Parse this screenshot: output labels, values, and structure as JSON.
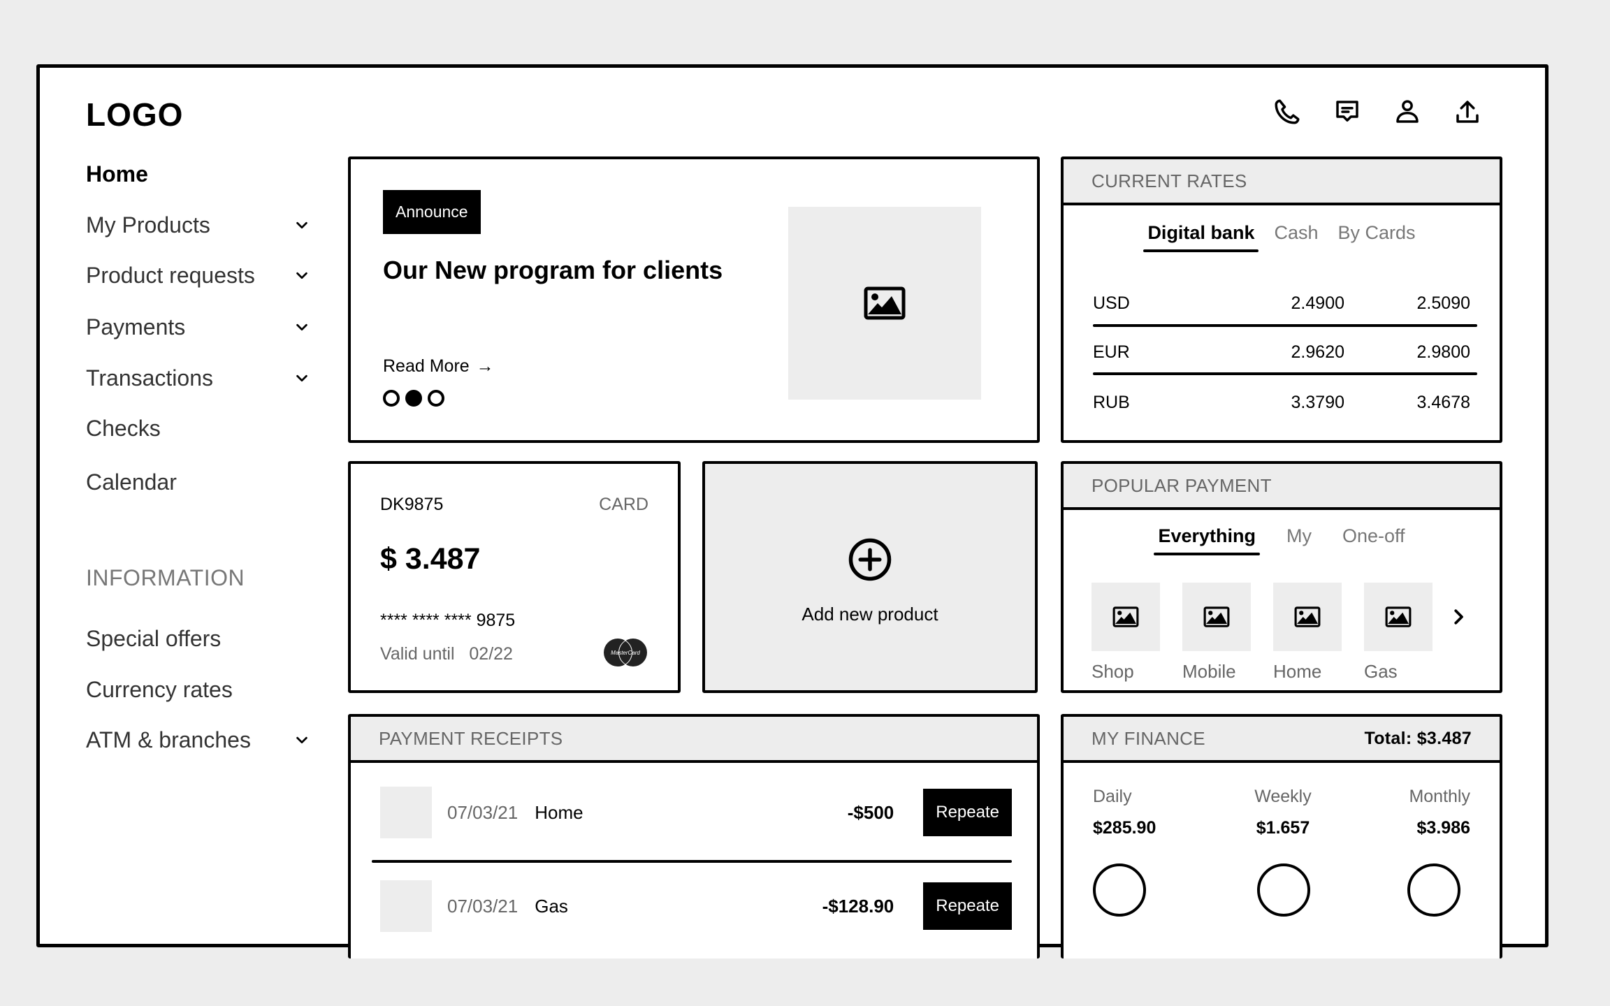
{
  "header": {
    "logo": "LOGO",
    "icons": [
      "phone-icon",
      "chat-icon",
      "user-icon",
      "upload-icon"
    ]
  },
  "sidebar": {
    "items": [
      {
        "label": "Home",
        "active": true,
        "expandable": false
      },
      {
        "label": "My Products",
        "expandable": true
      },
      {
        "label": "Product requests",
        "expandable": true
      },
      {
        "label": "Payments",
        "expandable": true
      },
      {
        "label": "Transactions",
        "expandable": true
      },
      {
        "label": "Checks",
        "expandable": false
      },
      {
        "label": "Calendar",
        "expandable": false
      }
    ],
    "info_heading": "INFORMATION",
    "info_items": [
      {
        "label": "Special offers",
        "expandable": false
      },
      {
        "label": "Currency rates",
        "expandable": false
      },
      {
        "label": "ATM & branches",
        "expandable": true
      }
    ]
  },
  "announce": {
    "badge": "Announce",
    "title": "Our New program for clients",
    "read_more": "Read More",
    "read_more_arrow": "→",
    "carousel_total": 3,
    "carousel_active": 2
  },
  "rates": {
    "title": "CURRENT RATES",
    "tabs": [
      {
        "label": "Digital bank",
        "active": true
      },
      {
        "label": "Cash",
        "active": false
      },
      {
        "label": "By Cards",
        "active": false
      }
    ],
    "rows": [
      {
        "currency": "USD",
        "buy": "2.4900",
        "sell": "2.5090"
      },
      {
        "currency": "EUR",
        "buy": "2.9620",
        "sell": "2.9800"
      },
      {
        "currency": "RUB",
        "buy": "3.3790",
        "sell": "3.4678"
      }
    ]
  },
  "card": {
    "id": "DK9875",
    "type": "CARD",
    "balance": "$ 3.487",
    "number": "**** **** **** 9875",
    "valid_label": "Valid until",
    "valid_date": "02/22",
    "brand": "MasterCard"
  },
  "add_product": {
    "label": "Add new product"
  },
  "popular": {
    "title": "POPULAR PAYMENT",
    "tabs": [
      {
        "label": "Everything",
        "active": true
      },
      {
        "label": "My",
        "active": false
      },
      {
        "label": "One-off",
        "active": false
      }
    ],
    "items": [
      {
        "label": "Shop"
      },
      {
        "label": "Mobile"
      },
      {
        "label": "Home"
      },
      {
        "label": "Gas"
      }
    ]
  },
  "receipts": {
    "title": "PAYMENT RECEIPTS",
    "rows": [
      {
        "date": "07/03/21",
        "name": "Home",
        "amount": "-$500",
        "action": "Repeate"
      },
      {
        "date": "07/03/21",
        "name": "Gas",
        "amount": "-$128.90",
        "action": "Repeate"
      }
    ]
  },
  "finance": {
    "title": "MY FINANCE",
    "total": "Total: $3.487",
    "periods": [
      {
        "label": "Daily",
        "value": "$285.90"
      },
      {
        "label": "Weekly",
        "value": "$1.657"
      },
      {
        "label": "Monthly",
        "value": "$3.986"
      }
    ]
  }
}
